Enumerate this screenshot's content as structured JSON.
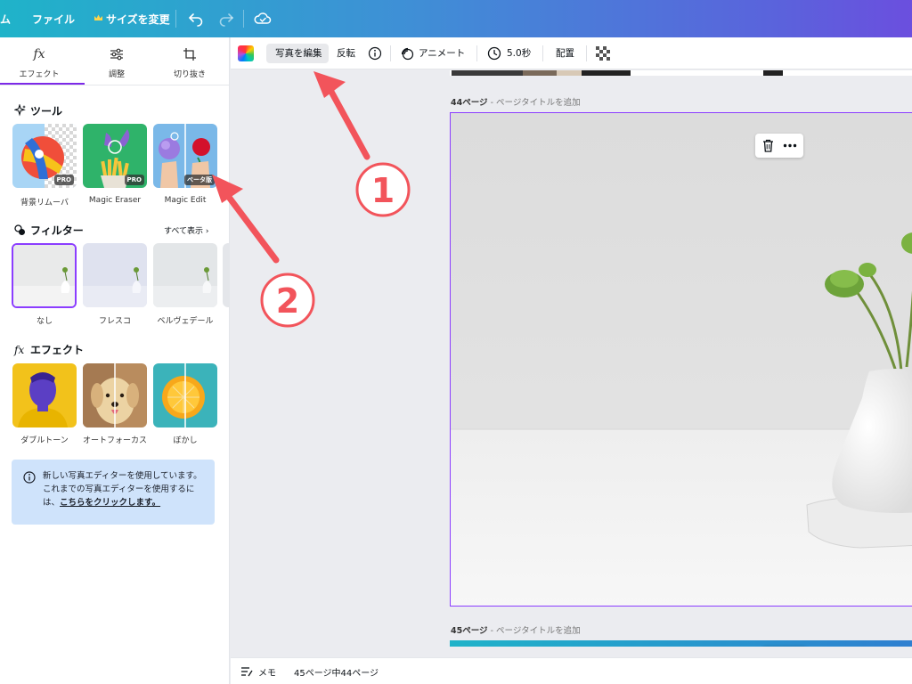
{
  "topbar": {
    "home_fragment": "ム",
    "file": "ファイル",
    "resize": "サイズを変更",
    "crown_icon": "crown-icon",
    "undo_icon": "undo-icon",
    "redo_icon": "redo-icon",
    "cloud_icon": "cloud-saved-icon"
  },
  "left_panel": {
    "tabs": [
      {
        "label": "エフェクト",
        "icon": "fx-icon",
        "active": true
      },
      {
        "label": "調整",
        "icon": "sliders-icon",
        "active": false
      },
      {
        "label": "切り抜き",
        "icon": "crop-icon",
        "active": false
      }
    ],
    "tools": {
      "title": "ツール",
      "icon": "sparkle-icon",
      "items": [
        {
          "label": "背景リムーバ",
          "badge": "PRO"
        },
        {
          "label": "Magic Eraser",
          "badge": "PRO"
        },
        {
          "label": "Magic Edit",
          "badge": "ベータ版"
        }
      ]
    },
    "filters": {
      "title": "フィルター",
      "icon": "filter-icon",
      "see_all": "すべて表示",
      "items": [
        {
          "label": "なし",
          "selected": true
        },
        {
          "label": "フレスコ",
          "selected": false
        },
        {
          "label": "ベルヴェデール",
          "selected": false
        }
      ]
    },
    "effects": {
      "title": "エフェクト",
      "icon": "fx-icon",
      "items": [
        {
          "label": "ダブルトーン"
        },
        {
          "label": "オートフォーカス"
        },
        {
          "label": "ぼかし"
        }
      ]
    },
    "notice": {
      "text": "新しい写真エディターを使用しています。これまでの写真エディターを使用するには、",
      "link": "こちらをクリックします。"
    }
  },
  "toolbar": {
    "edit_photo": "写真を編集",
    "flip": "反転",
    "animate": "アニメート",
    "duration": "5.0秒",
    "position": "配置",
    "colors": {
      "accent": "#8b3dff"
    }
  },
  "canvas": {
    "page44_label": "44ページ",
    "page44_sub": "- ページタイトルを追加",
    "page45_label": "45ページ",
    "page45_sub": "- ページタイトルを追加"
  },
  "bottombar": {
    "notes": "メモ",
    "page_count": "45ページ中44ページ"
  },
  "annotations": {
    "marker1": "1",
    "marker2": "2",
    "color": "#f2545b"
  }
}
